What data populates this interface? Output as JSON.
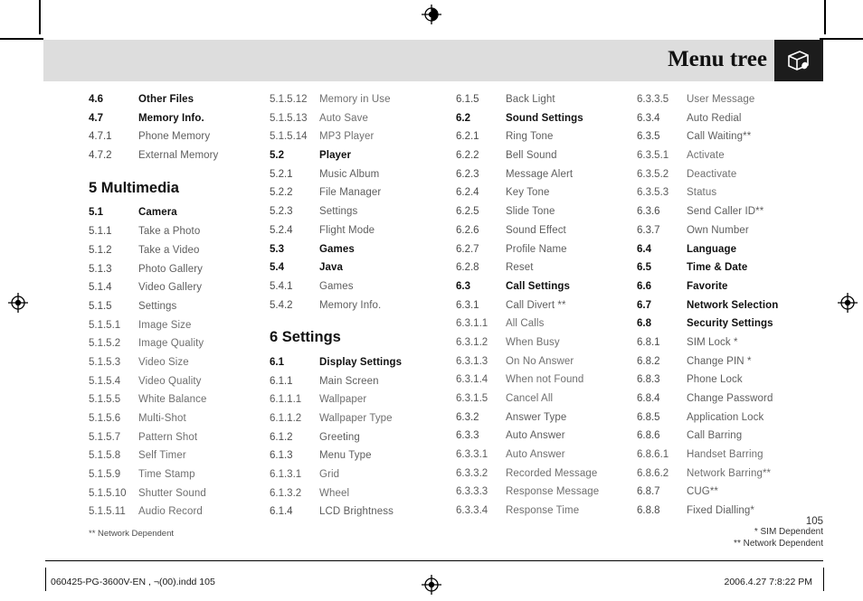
{
  "header": {
    "title": "Menu tree",
    "icon": "folder-clipboard-icon"
  },
  "columns": [
    {
      "id": "column-1",
      "entries": [
        {
          "type": "entry",
          "level": 1,
          "num": "4.6",
          "label": "Other Files"
        },
        {
          "type": "entry",
          "level": 1,
          "num": "4.7",
          "label": "Memory Info."
        },
        {
          "type": "entry",
          "level": 2,
          "num": "4.7.1",
          "label": "Phone Memory"
        },
        {
          "type": "entry",
          "level": 2,
          "num": "4.7.2",
          "label": "External Memory"
        },
        {
          "type": "spacer-half"
        },
        {
          "type": "section",
          "label": "5 Multimedia"
        },
        {
          "type": "spacer-half"
        },
        {
          "type": "entry",
          "level": 1,
          "num": "5.1",
          "label": "Camera"
        },
        {
          "type": "entry",
          "level": 2,
          "num": "5.1.1",
          "label": "Take a Photo"
        },
        {
          "type": "entry",
          "level": 2,
          "num": "5.1.2",
          "label": "Take a Video"
        },
        {
          "type": "entry",
          "level": 2,
          "num": "5.1.3",
          "label": "Photo Gallery"
        },
        {
          "type": "entry",
          "level": 2,
          "num": "5.1.4",
          "label": "Video Gallery"
        },
        {
          "type": "entry",
          "level": 2,
          "num": "5.1.5",
          "label": "Settings"
        },
        {
          "type": "entry",
          "level": 3,
          "num": "5.1.5.1",
          "label": "Image Size"
        },
        {
          "type": "entry",
          "level": 3,
          "num": "5.1.5.2",
          "label": "Image Quality"
        },
        {
          "type": "entry",
          "level": 3,
          "num": "5.1.5.3",
          "label": "Video Size"
        },
        {
          "type": "entry",
          "level": 3,
          "num": "5.1.5.4",
          "label": "Video Quality"
        },
        {
          "type": "entry",
          "level": 3,
          "num": "5.1.5.5",
          "label": "White Balance"
        },
        {
          "type": "entry",
          "level": 3,
          "num": "5.1.5.6",
          "label": "Multi-Shot"
        },
        {
          "type": "entry",
          "level": 3,
          "num": "5.1.5.7",
          "label": "Pattern Shot"
        },
        {
          "type": "entry",
          "level": 3,
          "num": "5.1.5.8",
          "label": "Self Timer"
        },
        {
          "type": "entry",
          "level": 3,
          "num": "5.1.5.9",
          "label": "Time Stamp"
        },
        {
          "type": "entry",
          "level": 3,
          "num": "5.1.5.10",
          "label": "Shutter Sound"
        },
        {
          "type": "entry",
          "level": 3,
          "num": "5.1.5.11",
          "label": "Audio Record"
        }
      ]
    },
    {
      "id": "column-2",
      "entries": [
        {
          "type": "entry",
          "level": 3,
          "num": "5.1.5.12",
          "label": "Memory in Use"
        },
        {
          "type": "entry",
          "level": 3,
          "num": "5.1.5.13",
          "label": "Auto Save"
        },
        {
          "type": "entry",
          "level": 3,
          "num": "5.1.5.14",
          "label": "MP3 Player"
        },
        {
          "type": "entry",
          "level": 1,
          "num": "5.2",
          "label": "Player"
        },
        {
          "type": "entry",
          "level": 2,
          "num": "5.2.1",
          "label": "Music Album"
        },
        {
          "type": "entry",
          "level": 2,
          "num": "5.2.2",
          "label": "File Manager"
        },
        {
          "type": "entry",
          "level": 2,
          "num": "5.2.3",
          "label": "Settings"
        },
        {
          "type": "entry",
          "level": 2,
          "num": "5.2.4",
          "label": "Flight Mode"
        },
        {
          "type": "entry",
          "level": 1,
          "num": "5.3",
          "label": "Games"
        },
        {
          "type": "entry",
          "level": 1,
          "num": "5.4",
          "label": "Java"
        },
        {
          "type": "entry",
          "level": 2,
          "num": "5.4.1",
          "label": "Games"
        },
        {
          "type": "entry",
          "level": 2,
          "num": "5.4.2",
          "label": "Memory Info."
        },
        {
          "type": "spacer-half"
        },
        {
          "type": "section",
          "label": "6 Settings"
        },
        {
          "type": "spacer-half"
        },
        {
          "type": "entry",
          "level": 1,
          "num": "6.1",
          "label": "Display Settings"
        },
        {
          "type": "entry",
          "level": 2,
          "num": "6.1.1",
          "label": "Main Screen"
        },
        {
          "type": "entry",
          "level": 3,
          "num": "6.1.1.1",
          "label": "Wallpaper"
        },
        {
          "type": "entry",
          "level": 3,
          "num": "6.1.1.2",
          "label": "Wallpaper Type"
        },
        {
          "type": "entry",
          "level": 2,
          "num": "6.1.2",
          "label": "Greeting"
        },
        {
          "type": "entry",
          "level": 2,
          "num": "6.1.3",
          "label": "Menu Type"
        },
        {
          "type": "entry",
          "level": 3,
          "num": "6.1.3.1",
          "label": "Grid"
        },
        {
          "type": "entry",
          "level": 3,
          "num": "6.1.3.2",
          "label": "Wheel"
        },
        {
          "type": "entry",
          "level": 2,
          "num": "6.1.4",
          "label": "LCD Brightness"
        }
      ]
    },
    {
      "id": "column-3",
      "entries": [
        {
          "type": "entry",
          "level": 2,
          "num": "6.1.5",
          "label": "Back Light"
        },
        {
          "type": "entry",
          "level": 1,
          "num": "6.2",
          "label": "Sound Settings"
        },
        {
          "type": "entry",
          "level": 2,
          "num": "6.2.1",
          "label": "Ring Tone"
        },
        {
          "type": "entry",
          "level": 2,
          "num": "6.2.2",
          "label": "Bell Sound"
        },
        {
          "type": "entry",
          "level": 2,
          "num": "6.2.3",
          "label": "Message Alert"
        },
        {
          "type": "entry",
          "level": 2,
          "num": "6.2.4",
          "label": "Key Tone"
        },
        {
          "type": "entry",
          "level": 2,
          "num": "6.2.5",
          "label": "Slide Tone"
        },
        {
          "type": "entry",
          "level": 2,
          "num": "6.2.6",
          "label": "Sound Effect"
        },
        {
          "type": "entry",
          "level": 2,
          "num": "6.2.7",
          "label": "Profile Name"
        },
        {
          "type": "entry",
          "level": 2,
          "num": "6.2.8",
          "label": "Reset"
        },
        {
          "type": "entry",
          "level": 1,
          "num": "6.3",
          "label": "Call Settings"
        },
        {
          "type": "entry",
          "level": 2,
          "num": "6.3.1",
          "label": "Call Divert **"
        },
        {
          "type": "entry",
          "level": 3,
          "num": "6.3.1.1",
          "label": "All Calls"
        },
        {
          "type": "entry",
          "level": 3,
          "num": "6.3.1.2",
          "label": "When Busy"
        },
        {
          "type": "entry",
          "level": 3,
          "num": "6.3.1.3",
          "label": "On No Answer"
        },
        {
          "type": "entry",
          "level": 3,
          "num": "6.3.1.4",
          "label": "When not Found"
        },
        {
          "type": "entry",
          "level": 3,
          "num": "6.3.1.5",
          "label": "Cancel All"
        },
        {
          "type": "entry",
          "level": 2,
          "num": "6.3.2",
          "label": "Answer Type"
        },
        {
          "type": "entry",
          "level": 2,
          "num": "6.3.3",
          "label": "Auto Answer"
        },
        {
          "type": "entry",
          "level": 3,
          "num": "6.3.3.1",
          "label": "Auto Answer"
        },
        {
          "type": "entry",
          "level": 3,
          "num": "6.3.3.2",
          "label": "Recorded Message"
        },
        {
          "type": "entry",
          "level": 3,
          "num": "6.3.3.3",
          "label": "Response Message"
        },
        {
          "type": "entry",
          "level": 3,
          "num": "6.3.3.4",
          "label": "Response Time"
        }
      ]
    },
    {
      "id": "column-4",
      "entries": [
        {
          "type": "entry",
          "level": 3,
          "num": "6.3.3.5",
          "label": "User Message"
        },
        {
          "type": "entry",
          "level": 2,
          "num": "6.3.4",
          "label": "Auto Redial"
        },
        {
          "type": "entry",
          "level": 2,
          "num": "6.3.5",
          "label": "Call Waiting**"
        },
        {
          "type": "entry",
          "level": 3,
          "num": "6.3.5.1",
          "label": "Activate"
        },
        {
          "type": "entry",
          "level": 3,
          "num": "6.3.5.2",
          "label": "Deactivate"
        },
        {
          "type": "entry",
          "level": 3,
          "num": "6.3.5.3",
          "label": "Status"
        },
        {
          "type": "entry",
          "level": 2,
          "num": "6.3.6",
          "label": "Send Caller ID**"
        },
        {
          "type": "entry",
          "level": 2,
          "num": "6.3.7",
          "label": "Own Number"
        },
        {
          "type": "entry",
          "level": 1,
          "num": "6.4",
          "label": "Language"
        },
        {
          "type": "entry",
          "level": 1,
          "num": "6.5",
          "label": "Time & Date"
        },
        {
          "type": "entry",
          "level": 1,
          "num": "6.6",
          "label": "Favorite"
        },
        {
          "type": "entry",
          "level": 1,
          "num": "6.7",
          "label": "Network Selection"
        },
        {
          "type": "entry",
          "level": 1,
          "num": "6.8",
          "label": "Security Settings"
        },
        {
          "type": "entry",
          "level": 2,
          "num": "6.8.1",
          "label": "SIM Lock *"
        },
        {
          "type": "entry",
          "level": 2,
          "num": "6.8.2",
          "label": "Change PIN *"
        },
        {
          "type": "entry",
          "level": 2,
          "num": "6.8.3",
          "label": "Phone Lock"
        },
        {
          "type": "entry",
          "level": 2,
          "num": "6.8.4",
          "label": "Change Password"
        },
        {
          "type": "entry",
          "level": 2,
          "num": "6.8.5",
          "label": "Application Lock"
        },
        {
          "type": "entry",
          "level": 2,
          "num": "6.8.6",
          "label": "Call Barring"
        },
        {
          "type": "entry",
          "level": 3,
          "num": "6.8.6.1",
          "label": "Handset Barring"
        },
        {
          "type": "entry",
          "level": 3,
          "num": "6.8.6.2",
          "label": "Network Barring**"
        },
        {
          "type": "entry",
          "level": 2,
          "num": "6.8.7",
          "label": "CUG**"
        },
        {
          "type": "entry",
          "level": 2,
          "num": "6.8.8",
          "label": "Fixed Dialling*"
        }
      ]
    }
  ],
  "footnotes": {
    "left": "** Network Dependent",
    "right_line1": "* SIM Dependent",
    "right_line2": "** Network Dependent"
  },
  "page_number": "105",
  "slug": {
    "left": "060425-PG-3600V-EN , ¬(00).indd   105",
    "right": "2006.4.27   7:8:22 PM"
  }
}
